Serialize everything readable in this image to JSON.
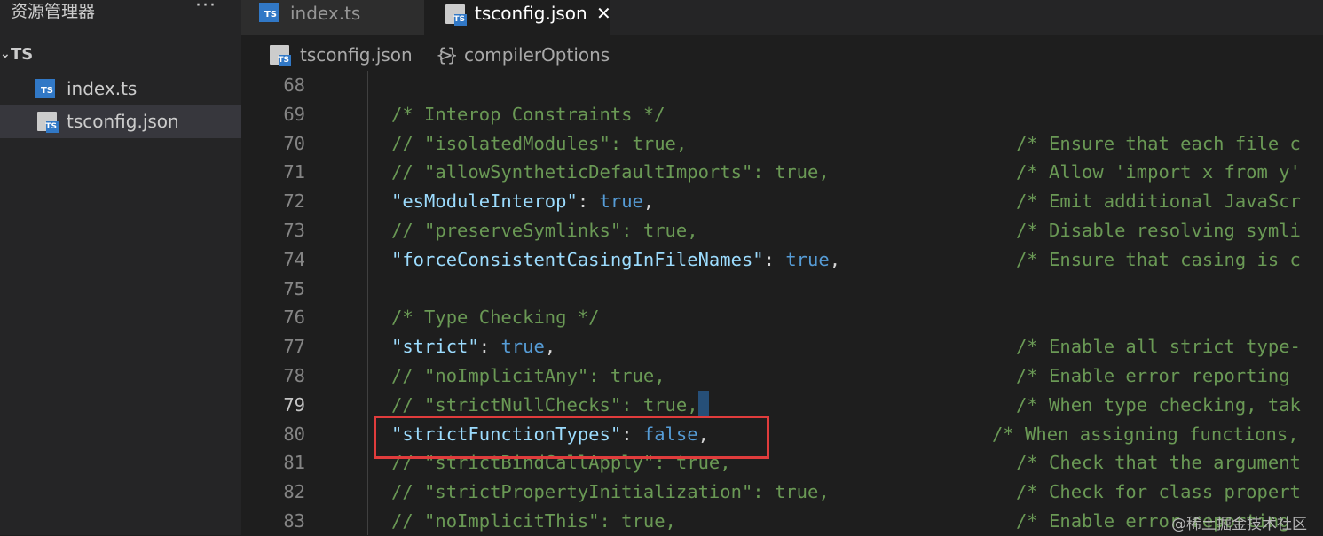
{
  "sidebar": {
    "title": "资源管理器",
    "more": "···",
    "folder": {
      "name": "TS"
    },
    "files": [
      {
        "name": "index.ts",
        "icon": "ts-icon",
        "active": false
      },
      {
        "name": "tsconfig.json",
        "icon": "tsconfig-icon",
        "active": true
      }
    ]
  },
  "tabs": [
    {
      "label": "index.ts",
      "active": false
    },
    {
      "label": "tsconfig.json",
      "active": true,
      "close": "✕"
    }
  ],
  "breadcrumb": {
    "file": "tsconfig.json",
    "separator": ">",
    "symbol": "{}",
    "section": "compilerOptions"
  },
  "editor": {
    "current_line": 79,
    "lines": [
      {
        "n": "68",
        "code": "",
        "comment": ""
      },
      {
        "n": "69",
        "code": "/* Interop Constraints */",
        "comment": ""
      },
      {
        "n": "70",
        "code": "// \"isolatedModules\": true,",
        "comment": "/* Ensure that each file c"
      },
      {
        "n": "71",
        "code": "// \"allowSyntheticDefaultImports\": true,",
        "comment": "/* Allow 'import x from y'"
      },
      {
        "n": "72",
        "key": "\"esModuleInterop\"",
        "value": "true",
        "comment": "/* Emit additional JavaScr"
      },
      {
        "n": "73",
        "code": "// \"preserveSymlinks\": true,",
        "comment": "/* Disable resolving symli"
      },
      {
        "n": "74",
        "key": "\"forceConsistentCasingInFileNames\"",
        "value": "true",
        "comment": "/* Ensure that casing is c"
      },
      {
        "n": "75",
        "code": "",
        "comment": ""
      },
      {
        "n": "76",
        "code": "/* Type Checking */",
        "comment": ""
      },
      {
        "n": "77",
        "key": "\"strict\"",
        "value": "true",
        "comment": "/* Enable all strict type-"
      },
      {
        "n": "78",
        "code": "// \"noImplicitAny\": true,",
        "comment": "/* Enable error reporting "
      },
      {
        "n": "79",
        "code": "// \"strictNullChecks\": true,",
        "comment": "/* When type checking, tak"
      },
      {
        "n": "80",
        "key": "\"strictFunctionTypes\"",
        "value": "false",
        "comment": "/* When assigning functions,"
      },
      {
        "n": "81",
        "code": "// \"strictBindCallApply\": true,",
        "comment": "/* Check that the argument"
      },
      {
        "n": "82",
        "code": "// \"strictPropertyInitialization\": true,",
        "comment": "/* Check for class propert"
      },
      {
        "n": "83",
        "code": "// \"noImplicitThis\": true,",
        "comment": "/* Enable error reporting "
      }
    ]
  },
  "watermark": "@稀土掘金技术社区",
  "colors": {
    "comment": "#6a9955",
    "key": "#9cdcfe",
    "boolean": "#569cd6",
    "highlight_border": "#e03c3c"
  }
}
